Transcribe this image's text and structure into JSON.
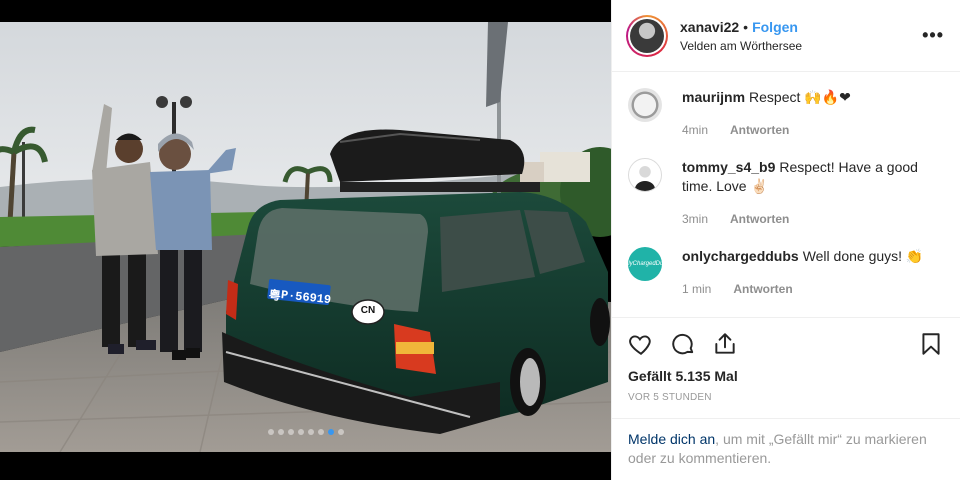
{
  "post": {
    "username": "xanavi22",
    "separator": "•",
    "follow_label": "Folgen",
    "location": "Velden am Wörthersee",
    "more_icon": "more-horizontal-icon"
  },
  "photo": {
    "plate_text": "P·56919",
    "plate_prefix_text": "粤",
    "cn_sticker": "CN",
    "carousel_count": 8,
    "carousel_active": 6
  },
  "comments": [
    {
      "user": "maurijnm",
      "text": "Respect 🙌🔥❤",
      "age": "4min",
      "reply": "Antworten",
      "avatar": "gauge"
    },
    {
      "user": "tommy_s4_b9",
      "text": "Respect! Have a good time. Love ✌🏻",
      "age": "3min",
      "reply": "Antworten",
      "avatar": "person"
    },
    {
      "user": "onlychargeddubs",
      "text": "Well done guys! 👏",
      "age": "1 min",
      "reply": "Antworten",
      "avatar": "brand"
    }
  ],
  "brand_avatar_text": "OnlyChargedDubs",
  "actions": {
    "like_icon": "heart-icon",
    "comment_icon": "comment-icon",
    "share_icon": "share-icon",
    "save_icon": "bookmark-icon"
  },
  "likes_text": "Gefällt 5.135 Mal",
  "time_text": "VOR 5 STUNDEN",
  "login": {
    "link_text": "Melde dich an",
    "rest_text": ", um mit „Gefällt mir“ zu markieren oder zu kommentieren."
  },
  "colors": {
    "link_blue": "#3897f0",
    "dark_link": "#003569",
    "meta_gray": "#8e8e8e",
    "car_green": "#123a2e"
  }
}
